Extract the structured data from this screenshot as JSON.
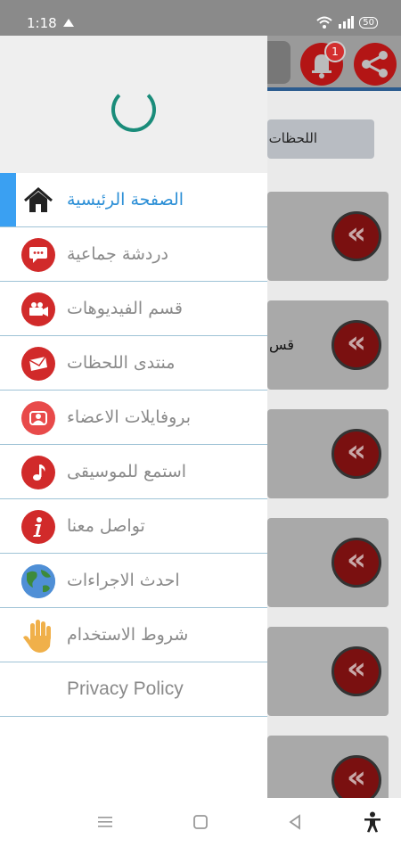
{
  "status": {
    "time": "1:18",
    "battery": "50"
  },
  "background": {
    "notification_count": "1",
    "tab_label": "اللحظات",
    "card_text": "قس"
  },
  "menu": {
    "items": [
      {
        "label": "الصفحة الرئيسية",
        "icon": "home-icon",
        "active": true
      },
      {
        "label": "دردشة جماعية",
        "icon": "chat-icon"
      },
      {
        "label": "قسم الفيديوهات",
        "icon": "video-camera-icon"
      },
      {
        "label": "منتدى اللحظات",
        "icon": "mail-icon"
      },
      {
        "label": "بروفايلات الاعضاء",
        "icon": "members-icon"
      },
      {
        "label": "استمع للموسيقى",
        "icon": "music-note-icon"
      },
      {
        "label": "تواصل معنا",
        "icon": "info-icon"
      },
      {
        "label": "احدث الاجراءات",
        "icon": "globe-icon"
      },
      {
        "label": "شروط الاستخدام",
        "icon": "hand-icon"
      },
      {
        "label": "Privacy Policy"
      }
    ]
  },
  "colors": {
    "accent": "#3aa0f2",
    "icon_red": "#d12a2a",
    "spinner": "#1a8c7a"
  }
}
